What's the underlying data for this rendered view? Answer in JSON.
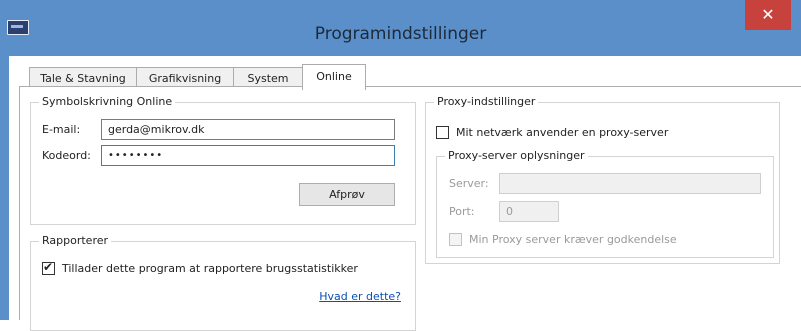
{
  "window": {
    "title": "Programindstillinger",
    "close_glyph": "✕"
  },
  "tabs": [
    "Tale & Stavning",
    "Grafikvisning",
    "System",
    "Online"
  ],
  "active_tab": "Online",
  "symbolskrivning": {
    "group_label": "Symbolskrivning Online",
    "email_label": "E-mail:",
    "email_value": "gerda@mikrov.dk",
    "password_label": "Kodeord:",
    "password_value": "••••••••",
    "test_button": "Afprøv"
  },
  "rapporterer": {
    "group_label": "Rapporterer",
    "allow_label": "Tillader dette program at rapportere brugsstatistikker",
    "allow_checked": true,
    "help_link": "Hvad er dette?"
  },
  "proxy": {
    "group_label": "Proxy-indstillinger",
    "use_proxy_label": "Mit netværk anvender en proxy-server",
    "use_proxy_checked": false,
    "details_label": "Proxy-server oplysninger",
    "server_label": "Server:",
    "server_value": "",
    "port_label": "Port:",
    "port_value": "0",
    "auth_label": "Min Proxy server kræver godkendelse",
    "auth_checked": false
  }
}
